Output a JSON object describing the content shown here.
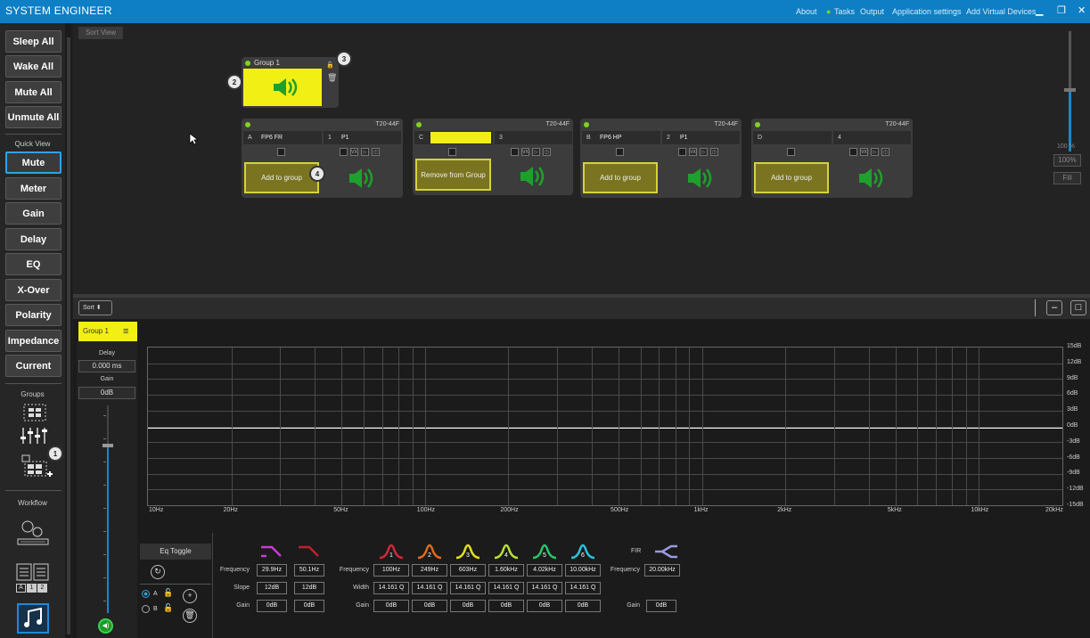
{
  "app": {
    "title": "SYSTEM ENGINEER"
  },
  "menu": {
    "about": "About",
    "tasks": "Tasks",
    "output": "Output",
    "settings": "Application settings",
    "add_devices": "Add Virtual Devices"
  },
  "sidebar": {
    "buttons": [
      "Sleep All",
      "Wake All",
      "Mute All",
      "Unmute All"
    ],
    "quick_view_label": "Quick View",
    "views": [
      "Mute",
      "Meter",
      "Gain",
      "Delay",
      "EQ",
      "X-Over",
      "Polarity",
      "Impedance",
      "Current"
    ],
    "active_view": "Mute",
    "groups_label": "Groups",
    "workflow_label": "Workflow",
    "workflow_tabs": [
      "A",
      "1",
      "2"
    ]
  },
  "badges": {
    "b1": "1",
    "b2": "2",
    "b3": "3",
    "b4": "4"
  },
  "canvas": {
    "sort_view": "Sort View",
    "group": {
      "name": "Group 1"
    },
    "devices": [
      {
        "model": "T20-44F",
        "ch": "A",
        "name": "FP6 FR",
        "out_num": "1",
        "out_name": "P1",
        "action": "Add to group"
      },
      {
        "model": "T20-44F",
        "ch": "C",
        "name": "",
        "out_num": "3",
        "out_name": "",
        "action": "Remove from Group"
      },
      {
        "model": "T20-44F",
        "ch": "B",
        "name": "FP6 HP",
        "out_num": "2",
        "out_name": "P1",
        "action": "Add to group"
      },
      {
        "model": "T20-44F",
        "ch": "D",
        "name": "",
        "out_num": "4",
        "out_name": "",
        "action": "Add to group"
      }
    ],
    "mini_labels": [
      "VX",
      "▷",
      "◫"
    ],
    "zoom": {
      "percent": "100 %",
      "btn100": "100%",
      "fill": "Fill",
      "level": 1.0
    }
  },
  "bottom": {
    "sort": "Sort",
    "group_tab": "Group 1",
    "delay_label": "Delay",
    "delay_value": "0.000 ms",
    "gain_label": "Gain",
    "gain_value": "0dB",
    "fader_level": 0.8
  },
  "plot": {
    "x_labels": [
      "10Hz",
      "20Hz",
      "50Hz",
      "100Hz",
      "200Hz",
      "500Hz",
      "1kHz",
      "2kHz",
      "5kHz",
      "10kHz",
      "20kHz"
    ],
    "y_labels": [
      "15dB",
      "12dB",
      "9dB",
      "6dB",
      "3dB",
      "0dB",
      "-3dB",
      "-6dB",
      "-9dB",
      "-12dB",
      "-15dB"
    ]
  },
  "eq": {
    "toggle": "Eq Toggle",
    "preset_a": "A",
    "preset_b": "B",
    "row_frequency": "Frequency",
    "row_slope": "Slope",
    "row_width": "Width",
    "row_gain": "Gain",
    "filters": [
      {
        "color": "#c93ad6",
        "freq": "29.9Hz",
        "slope": "12dB",
        "gain": "0dB"
      },
      {
        "color": "#c41f2a",
        "freq": "50.1Hz",
        "slope": "12dB",
        "gain": "0dB"
      }
    ],
    "bands": [
      {
        "num": "1",
        "color": "#d0283a",
        "freq": "100Hz",
        "width": "14.161 Q",
        "gain": "0dB"
      },
      {
        "num": "2",
        "color": "#e06a1a",
        "freq": "249Hz",
        "width": "14.161 Q",
        "gain": "0dB"
      },
      {
        "num": "3",
        "color": "#e3e01c",
        "freq": "603Hz",
        "width": "14.161 Q",
        "gain": "0dB"
      },
      {
        "num": "4",
        "color": "#b6e036",
        "freq": "1.60kHz",
        "width": "14.161 Q",
        "gain": "0dB"
      },
      {
        "num": "5",
        "color": "#27c46a",
        "freq": "4.02kHz",
        "width": "14.161 Q",
        "gain": "0dB"
      },
      {
        "num": "6",
        "color": "#2bc0d8",
        "freq": "10.00kHz",
        "width": "14.161 Q",
        "gain": "0dB"
      }
    ],
    "fir": {
      "label": "FIR",
      "color": "#9a9ae0",
      "freq": "20.00kHz",
      "gain": "0dB"
    }
  }
}
